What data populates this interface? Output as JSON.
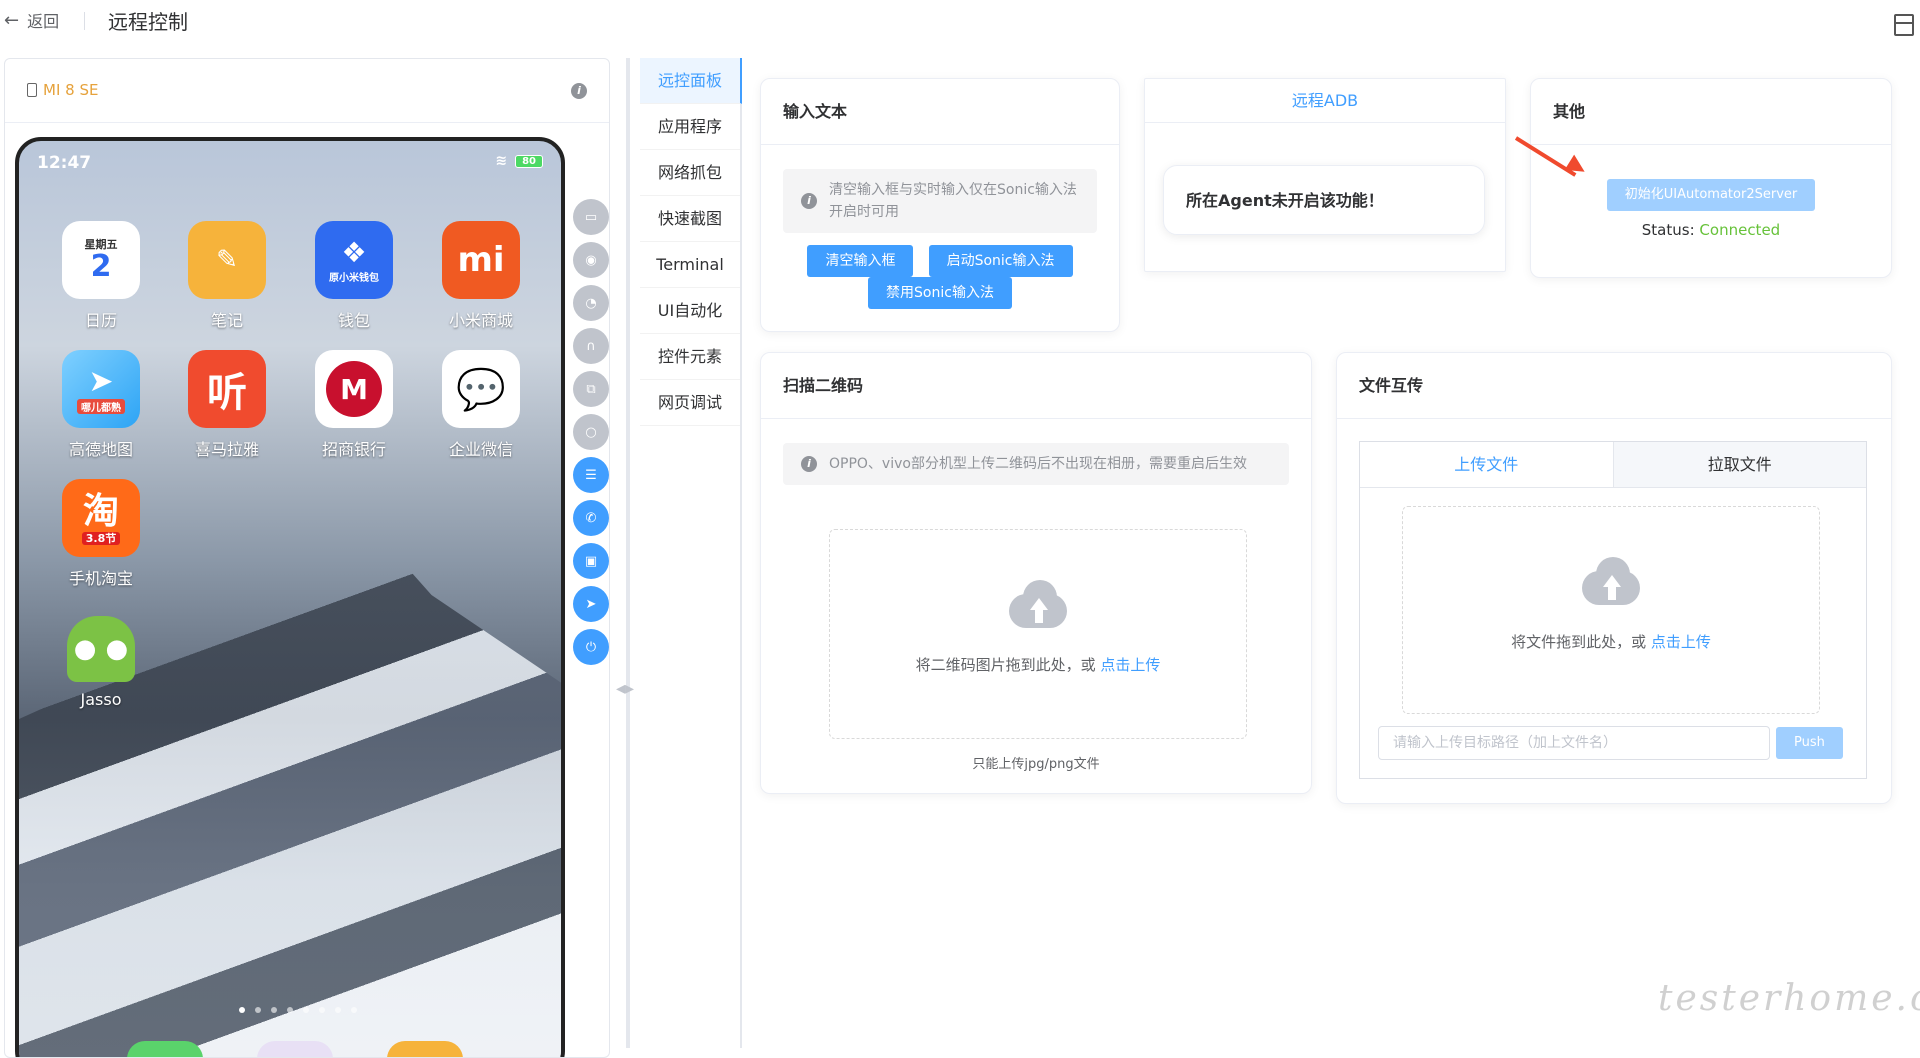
{
  "header": {
    "back_label": "返回",
    "title": "远程控制"
  },
  "device": {
    "name": "MI 8 SE",
    "status_time": "12:47",
    "battery": "80",
    "apps": [
      {
        "label": "日历",
        "top_text": "星期五",
        "big_text": "2",
        "color": "#ffffff"
      },
      {
        "label": "笔记",
        "color": "#f6b33b"
      },
      {
        "label": "钱包",
        "inner": "原小米钱包",
        "color": "#2f6bf0"
      },
      {
        "label": "小米商城",
        "inner": "mi",
        "color": "#f05a22"
      },
      {
        "label": "高德地图",
        "inner": "哪儿都熟",
        "color": "#2da4f5"
      },
      {
        "label": "喜马拉雅",
        "inner": "听",
        "color": "#f04b2e"
      },
      {
        "label": "招商银行",
        "color": "#ffffff"
      },
      {
        "label": "企业微信",
        "color": "#ffffff"
      },
      {
        "label": "手机淘宝",
        "inner": "淘",
        "badge": "3.8节",
        "color": "#ff6a18"
      },
      {
        "label": "Jasso",
        "color": "#7cc245"
      }
    ]
  },
  "nav": {
    "items": [
      "远控面板",
      "应用程序",
      "网络抓包",
      "快速截图",
      "Terminal",
      "UI自动化",
      "控件元素",
      "网页调试"
    ]
  },
  "input_card": {
    "title": "输入文本",
    "alert": "清空输入框与实时输入仅在Sonic输入法开启时可用",
    "btn_clear": "清空输入框",
    "btn_enable": "启动Sonic输入法",
    "btn_disable": "禁用Sonic输入法"
  },
  "adb_card": {
    "title": "远程ADB",
    "message": "所在Agent未开启该功能！"
  },
  "other_card": {
    "title": "其他",
    "init_button": "初始化UIAutomator2Server",
    "status_label": "Status:",
    "status_value": "Connected",
    "status_color": "#67c23a"
  },
  "qr_card": {
    "title": "扫描二维码",
    "alert": "OPPO、vivo部分机型上传二维码后不出现在相册，需要重启后生效",
    "drop_text": "将二维码图片拖到此处，或",
    "drop_link": "点击上传",
    "tip": "只能上传jpg/png文件"
  },
  "file_card": {
    "title": "文件互传",
    "tab_upload": "上传文件",
    "tab_pull": "拉取文件",
    "drop_text": "将文件拖到此处，或",
    "drop_link": "点击上传",
    "path_placeholder": "请输入上传目标路径（加上文件名）",
    "push_label": "Push"
  },
  "watermark": "testerhome.com",
  "accent_color": "#409eff"
}
